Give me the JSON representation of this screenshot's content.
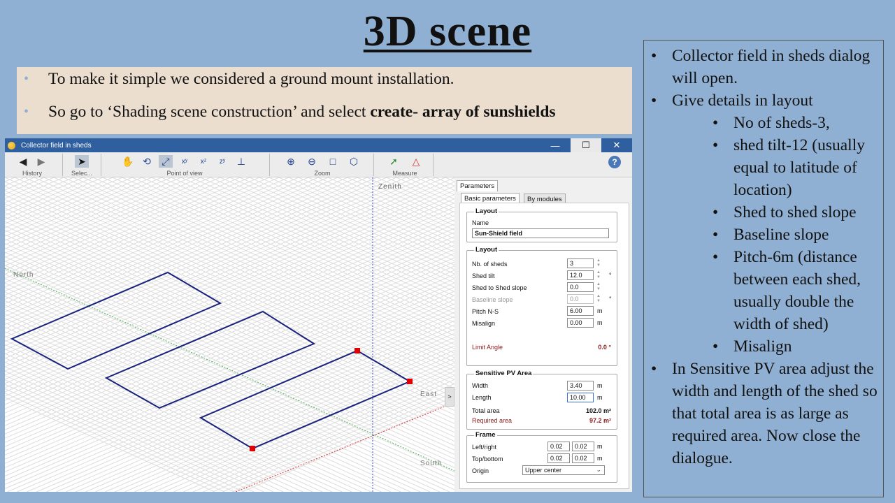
{
  "slide": {
    "title": "3D scene",
    "intro": [
      {
        "text": "To make it simple we considered a ground mount installation.",
        "bold": ""
      },
      {
        "text": "So go to ‘Shading scene construction’ and select ",
        "bold": "create- array of sunshields"
      }
    ],
    "notes": {
      "bullets": [
        "Collector field in sheds dialog will open.",
        "Give details in layout"
      ],
      "sub_bullets": [
        "No of sheds-3,",
        " shed tilt-12 (usually equal to latitude of location)",
        "Shed to shed slope",
        "Baseline slope",
        "Pitch-6m (distance between each shed, usually double the width of shed)",
        "Misalign"
      ],
      "last_bullet": "In Sensitive PV area adjust the width and length of the shed so that total area is as large as required area. Now close the dialogue."
    }
  },
  "window": {
    "title": "Collector field in sheds",
    "minimize": "—",
    "maximize": "☐",
    "close": "✕",
    "toolbar": {
      "history_label": "History",
      "select_label": "Selec...",
      "pov_label": "Point of view",
      "zoom_label": "Zoom",
      "measure_label": "Measure",
      "help": "?"
    },
    "viewport": {
      "zenith": "Zenith",
      "north": "North",
      "east": "East",
      "south": "South",
      "collapse": ">"
    },
    "panel": {
      "tab_parameters": "Parameters",
      "tab_basic": "Basic parameters",
      "tab_modules": "By modules",
      "layout_group": "Layout",
      "name_label": "Name",
      "name_value": "Sun-Shield field",
      "layout2_group": "Layout",
      "nb_sheds_label": "Nb. of sheds",
      "nb_sheds_value": "3",
      "shed_tilt_label": "Shed tilt",
      "shed_tilt_value": "12.0",
      "shed_tilt_unit": "°",
      "shed_slope_label": "Shed to Shed slope",
      "shed_slope_value": "0.0",
      "baseline_label": "Baseline slope",
      "baseline_value": "0.0",
      "baseline_unit": "°",
      "pitch_label": "Pitch N-S",
      "pitch_value": "6.00",
      "pitch_unit": "m",
      "misalign_label": "Misalign",
      "misalign_value": "0.00",
      "misalign_unit": "m",
      "limit_label": "Limit Angle",
      "limit_value": "0.0 °",
      "pv_group": "Sensitive PV Area",
      "width_label": "Width",
      "width_value": "3.40",
      "width_unit": "m",
      "length_label": "Length",
      "length_value": "10.00",
      "length_unit": "m",
      "total_label": "Total area",
      "total_value": "102.0 m²",
      "required_label": "Required area",
      "required_value": "97.2 m²",
      "frame_group": "Frame",
      "lr_label": "Left/right",
      "lr_value1": "0.02",
      "lr_value2": "0.02",
      "lr_unit": "m",
      "tb_label": "Top/bottom",
      "tb_value1": "0.02",
      "tb_value2": "0.02",
      "tb_unit": "m",
      "origin_label": "Origin",
      "origin_value": "Upper center"
    }
  }
}
